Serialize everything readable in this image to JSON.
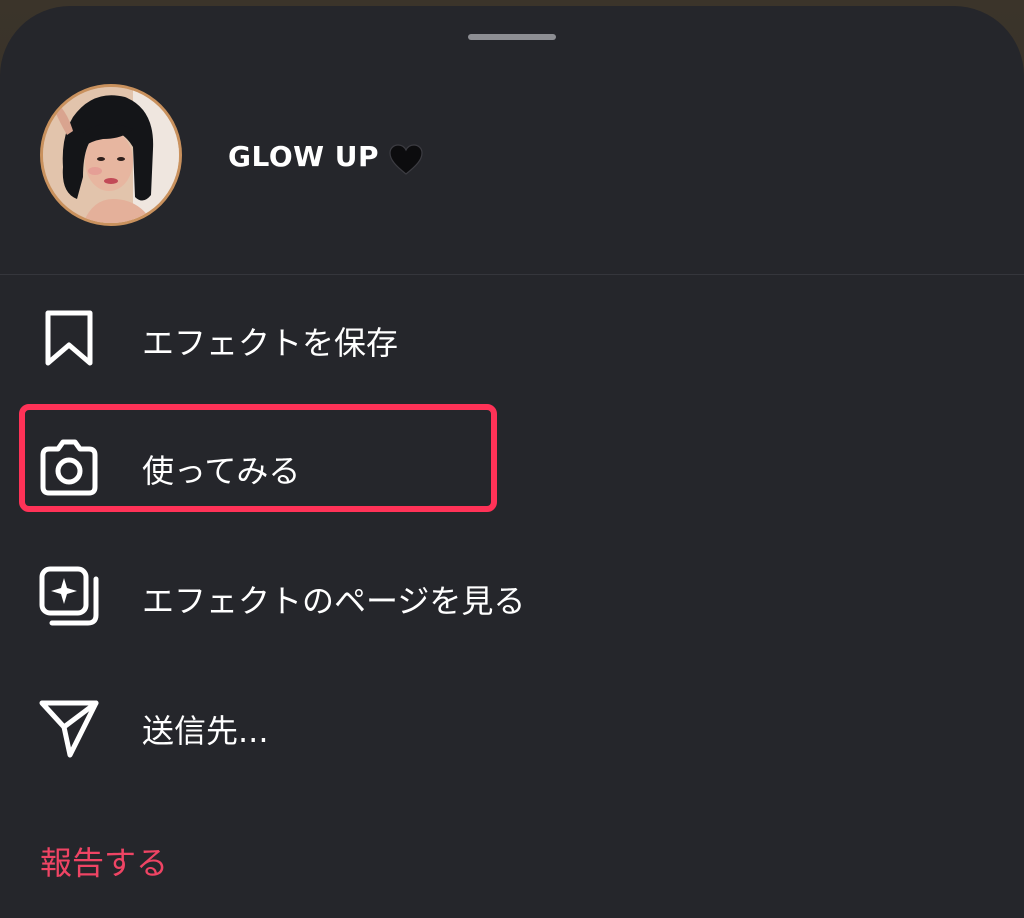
{
  "colors": {
    "sheet_background": "#25262b",
    "text_primary": "#ffffff",
    "report_text": "#ef4464",
    "highlight_border": "#ff3257"
  },
  "effect": {
    "name": "GLOW UP",
    "avatar_icon": "profile-photo",
    "heart_icon": "black-heart-emoji"
  },
  "menu": {
    "items": [
      {
        "label": "エフェクトを保存",
        "icon": "bookmark-icon"
      },
      {
        "label": "使ってみる",
        "icon": "camera-icon",
        "highlighted": true
      },
      {
        "label": "エフェクトのページを見る",
        "icon": "effect-page-icon"
      },
      {
        "label": "送信先...",
        "icon": "send-icon"
      }
    ],
    "report_label": "報告する"
  }
}
